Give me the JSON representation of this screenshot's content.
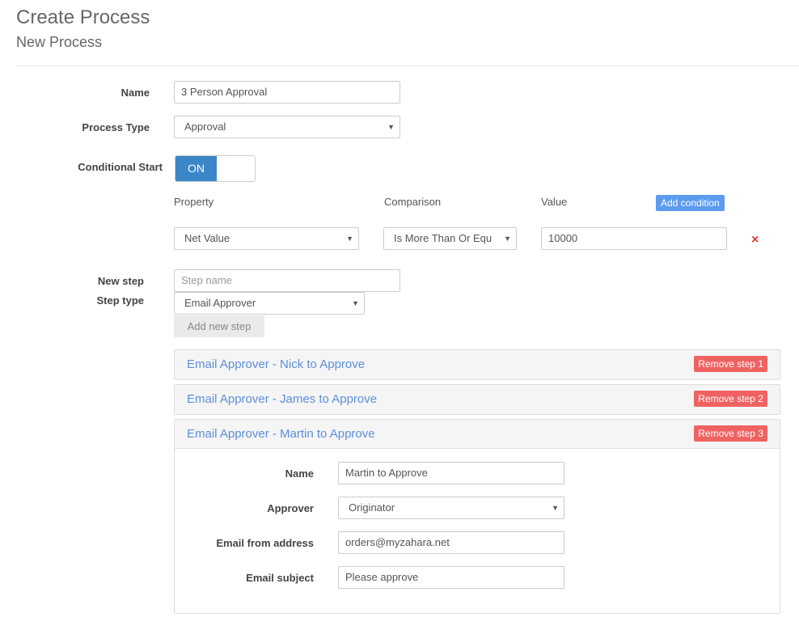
{
  "header": {
    "title": "Create Process",
    "subtitle": "New Process"
  },
  "form": {
    "name_label": "Name",
    "name_value": "3 Person Approval",
    "process_type_label": "Process Type",
    "process_type_value": "Approval",
    "conditional_start_label": "Conditional Start",
    "toggle_on": "ON"
  },
  "conditions": {
    "property_header": "Property",
    "comparison_header": "Comparison",
    "value_header": "Value",
    "add_condition_label": "Add condition",
    "rows": [
      {
        "property": "Net Value",
        "comparison": "Is More Than Or Equ",
        "value": "10000",
        "remove_icon": "×"
      }
    ]
  },
  "new_step": {
    "new_step_label": "New step",
    "step_type_label": "Step type",
    "step_name_placeholder": "Step name",
    "step_type_value": "Email Approver",
    "add_button": "Add new step"
  },
  "steps": [
    {
      "title": "Email Approver - Nick to Approve",
      "remove_label": "Remove step 1"
    },
    {
      "title": "Email Approver - James to Approve",
      "remove_label": "Remove step 2"
    },
    {
      "title": "Email Approver - Martin to Approve",
      "remove_label": "Remove step 3"
    }
  ],
  "expanded_step": {
    "name_label": "Name",
    "name_value": "Martin to Approve",
    "approver_label": "Approver",
    "approver_value": "Originator",
    "email_from_label": "Email from address",
    "email_from_value": "orders@myzahara.net",
    "email_subject_label": "Email subject",
    "email_subject_value": "Please approve"
  },
  "icons": {
    "caret": "▼"
  },
  "colors": {
    "primary": "#3a86c8",
    "link": "#5b8fd9",
    "danger": "#f06262",
    "add_button": "#5b9bf0"
  }
}
